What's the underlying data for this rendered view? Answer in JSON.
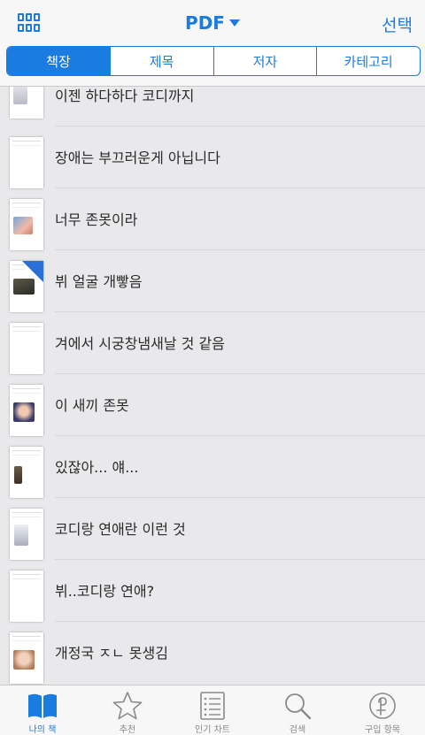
{
  "header": {
    "title": "PDF",
    "select_label": "선택"
  },
  "segments": [
    {
      "label": "책장",
      "active": true
    },
    {
      "label": "제목",
      "active": false
    },
    {
      "label": "저자",
      "active": false
    },
    {
      "label": "카테고리",
      "active": false
    }
  ],
  "books": [
    {
      "title": "이젠 하다하다 코디까지",
      "thumb": "photo-small"
    },
    {
      "title": "장애는 부끄러운게 아닙니다",
      "thumb": "text-only"
    },
    {
      "title": "너무 존못이라",
      "thumb": "photo-color"
    },
    {
      "title": "뷔 얼굴 개빻음",
      "thumb": "photo-blue-corner"
    },
    {
      "title": "겨에서 시궁창냄새날 것 같음",
      "thumb": "text-only"
    },
    {
      "title": "이 새끼 존못",
      "thumb": "photo-blue"
    },
    {
      "title": "있잖아... 얘...",
      "thumb": "photo-narrow"
    },
    {
      "title": "코디랑 연애란 이런 것",
      "thumb": "photo-small"
    },
    {
      "title": "뷔..코디랑 연애?",
      "thumb": "text-only"
    },
    {
      "title": "개정국 ㅈㄴ 못생김",
      "thumb": "photo-warm"
    }
  ],
  "tabs": [
    {
      "label": "나의 책",
      "icon": "book-icon",
      "active": true
    },
    {
      "label": "추천",
      "icon": "star-icon",
      "active": false
    },
    {
      "label": "인기 차트",
      "icon": "list-icon",
      "active": false
    },
    {
      "label": "검색",
      "icon": "search-icon",
      "active": false
    },
    {
      "label": "구입 항목",
      "icon": "purchase-icon",
      "active": false
    }
  ],
  "colors": {
    "accent": "#1a7be0",
    "list_background": "#e9e8eb",
    "bar_background": "#f7f7f7"
  }
}
